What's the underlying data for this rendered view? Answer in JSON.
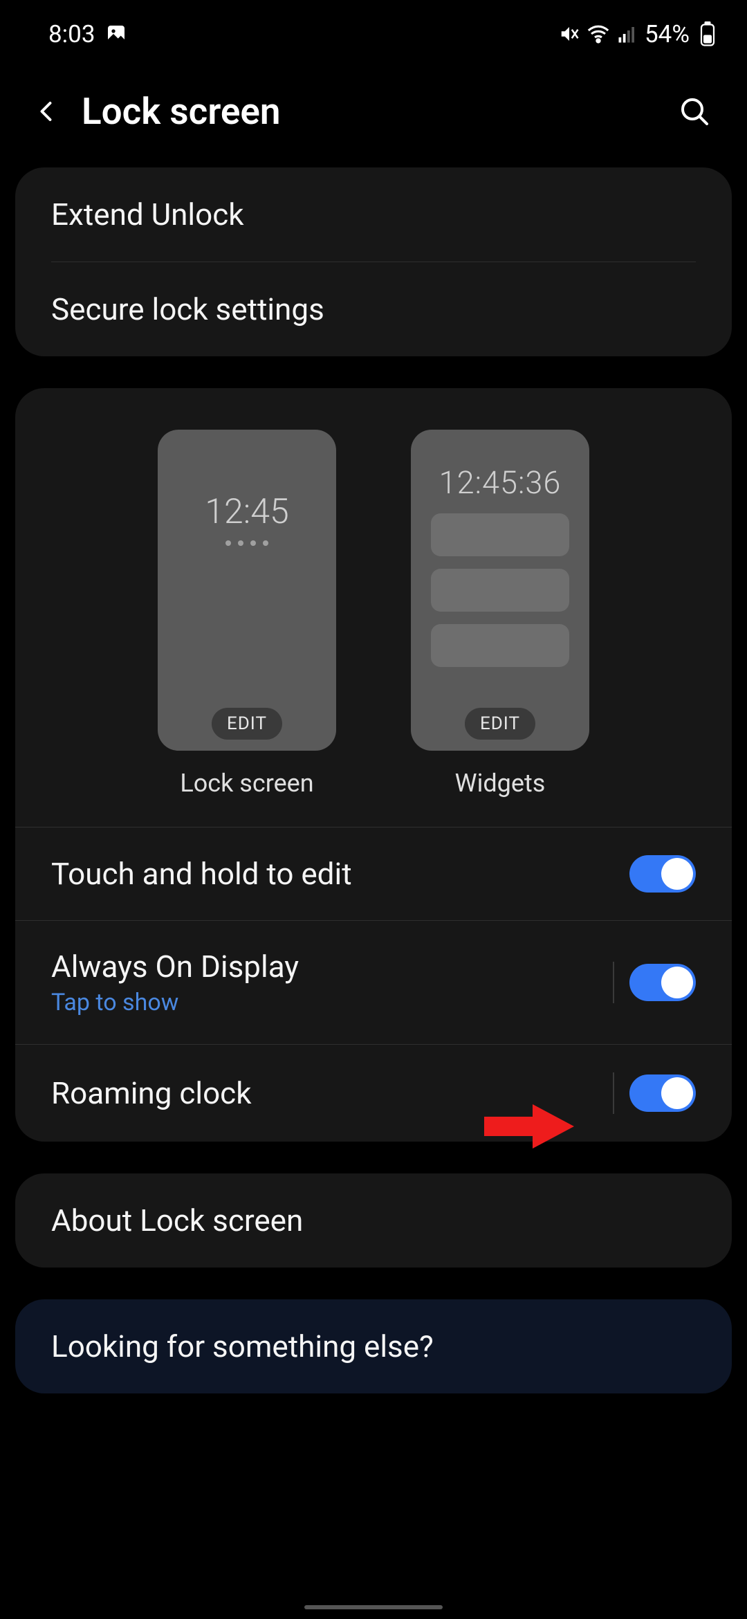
{
  "status_bar": {
    "time": "8:03",
    "battery_pct": "54%"
  },
  "header": {
    "title": "Lock screen"
  },
  "group1": {
    "extend_unlock": "Extend Unlock",
    "secure_lock": "Secure lock settings"
  },
  "previews": {
    "lockscreen": {
      "clock": "12:45",
      "edit": "EDIT",
      "label": "Lock screen"
    },
    "widgets": {
      "clock": "12:45:36",
      "edit": "EDIT",
      "label": "Widgets"
    }
  },
  "toggles": {
    "touch_hold": {
      "title": "Touch and hold to edit",
      "on": true
    },
    "aod": {
      "title": "Always On Display",
      "subtitle": "Tap to show",
      "on": true
    },
    "roaming": {
      "title": "Roaming clock",
      "on": true
    }
  },
  "about": {
    "title": "About Lock screen"
  },
  "footer": {
    "title": "Looking for something else?"
  }
}
